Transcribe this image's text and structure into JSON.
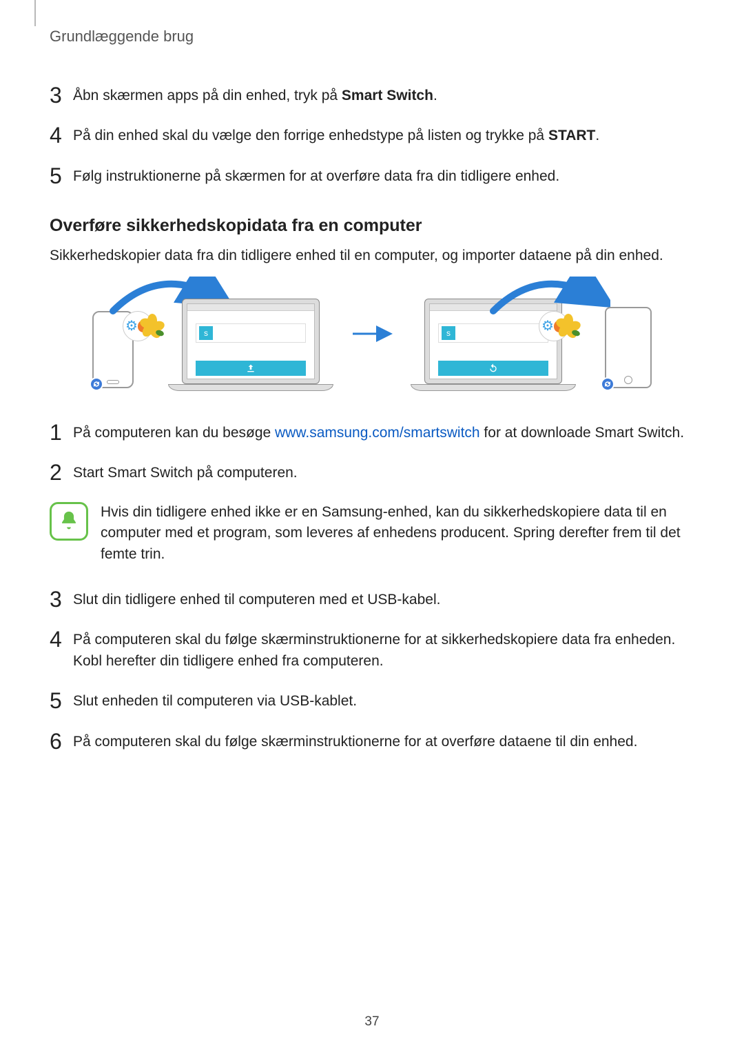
{
  "header": {
    "title": "Grundlæggende brug"
  },
  "topSteps": [
    {
      "num": "3",
      "text_before": "Åbn skærmen apps på din enhed, tryk på ",
      "bold": "Smart Switch",
      "text_after": "."
    },
    {
      "num": "4",
      "text_before": "På din enhed skal du vælge den forrige enhedstype på listen og trykke på ",
      "bold": "START",
      "text_after": "."
    },
    {
      "num": "5",
      "text_before": "Følg instruktionerne på skærmen for at overføre data fra din tidligere enhed.",
      "bold": "",
      "text_after": ""
    }
  ],
  "section": {
    "heading": "Overføre sikkerhedskopidata fra en computer",
    "intro": "Sikkerhedskopier data fra din tidligere enhed til en computer, og importer dataene på din enhed."
  },
  "lowerSteps": {
    "s1": {
      "num": "1",
      "before": "På computeren kan du besøge ",
      "link": "www.samsung.com/smartswitch",
      "after": " for at downloade Smart Switch."
    },
    "s2": {
      "num": "2",
      "text": "Start Smart Switch på computeren."
    },
    "note": "Hvis din tidligere enhed ikke er en Samsung-enhed, kan du sikkerhedskopiere data til en computer med et program, som leveres af enhedens producent. Spring derefter frem til det femte trin.",
    "s3": {
      "num": "3",
      "text": "Slut din tidligere enhed til computeren med et USB-kabel."
    },
    "s4": {
      "num": "4",
      "text": "På computeren skal du følge skærminstruktionerne for at sikkerhedskopiere data fra enheden. Kobl herefter din tidligere enhed fra computeren."
    },
    "s5": {
      "num": "5",
      "text": "Slut enheden til computeren via USB-kablet."
    },
    "s6": {
      "num": "6",
      "text": "På computeren skal du følge skærminstruktionerne for at overføre dataene til din enhed."
    }
  },
  "pageNumber": "37",
  "icons": {
    "s_badge": "s"
  }
}
